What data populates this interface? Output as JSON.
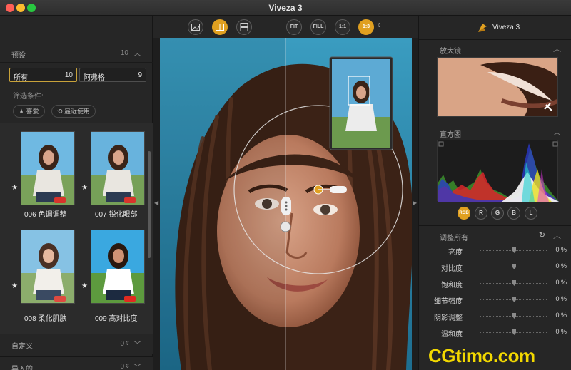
{
  "window": {
    "title": "Viveza 3"
  },
  "left_panel": {
    "presets": {
      "title": "预设",
      "count": "10"
    },
    "boxes": [
      {
        "label": "所有",
        "count": "10"
      },
      {
        "label": "阿弗格",
        "count": "9"
      }
    ],
    "filter_label": "筛选条件:",
    "filter_chips": [
      "★ 喜爱",
      "⟲ 最近使用"
    ],
    "thumbnails": [
      {
        "caption": "006 色调调整"
      },
      {
        "caption": "007 锐化眼部"
      },
      {
        "caption": "008 柔化肌肤"
      },
      {
        "caption": "009 高对比度"
      }
    ],
    "custom": {
      "title": "自定义",
      "count": "0"
    },
    "imported": {
      "title": "导入的",
      "count": "0"
    }
  },
  "toolbar": {
    "zoom_buttons": [
      "FIT",
      "FILL",
      "1:1",
      "1:3"
    ],
    "active_zoom": "1:3"
  },
  "right_panel": {
    "brand": "Viveza 3",
    "loupe_title": "放大镜",
    "histogram_title": "直方图",
    "channel_buttons": [
      "RGB",
      "R",
      "G",
      "B",
      "L"
    ],
    "adjust_title": "调整所有",
    "sliders": [
      {
        "label": "亮度",
        "value": "0 %"
      },
      {
        "label": "对比度",
        "value": "0 %"
      },
      {
        "label": "饱和度",
        "value": "0 %"
      },
      {
        "label": "细节强度",
        "value": "0 %"
      },
      {
        "label": "阴影调整",
        "value": "0 %"
      },
      {
        "label": "温和度",
        "value": "0 %"
      }
    ]
  },
  "watermark": "CGtimo.com",
  "colors": {
    "accent": "#e0a020",
    "panel": "#262626",
    "sky": "#2a7fa0"
  }
}
